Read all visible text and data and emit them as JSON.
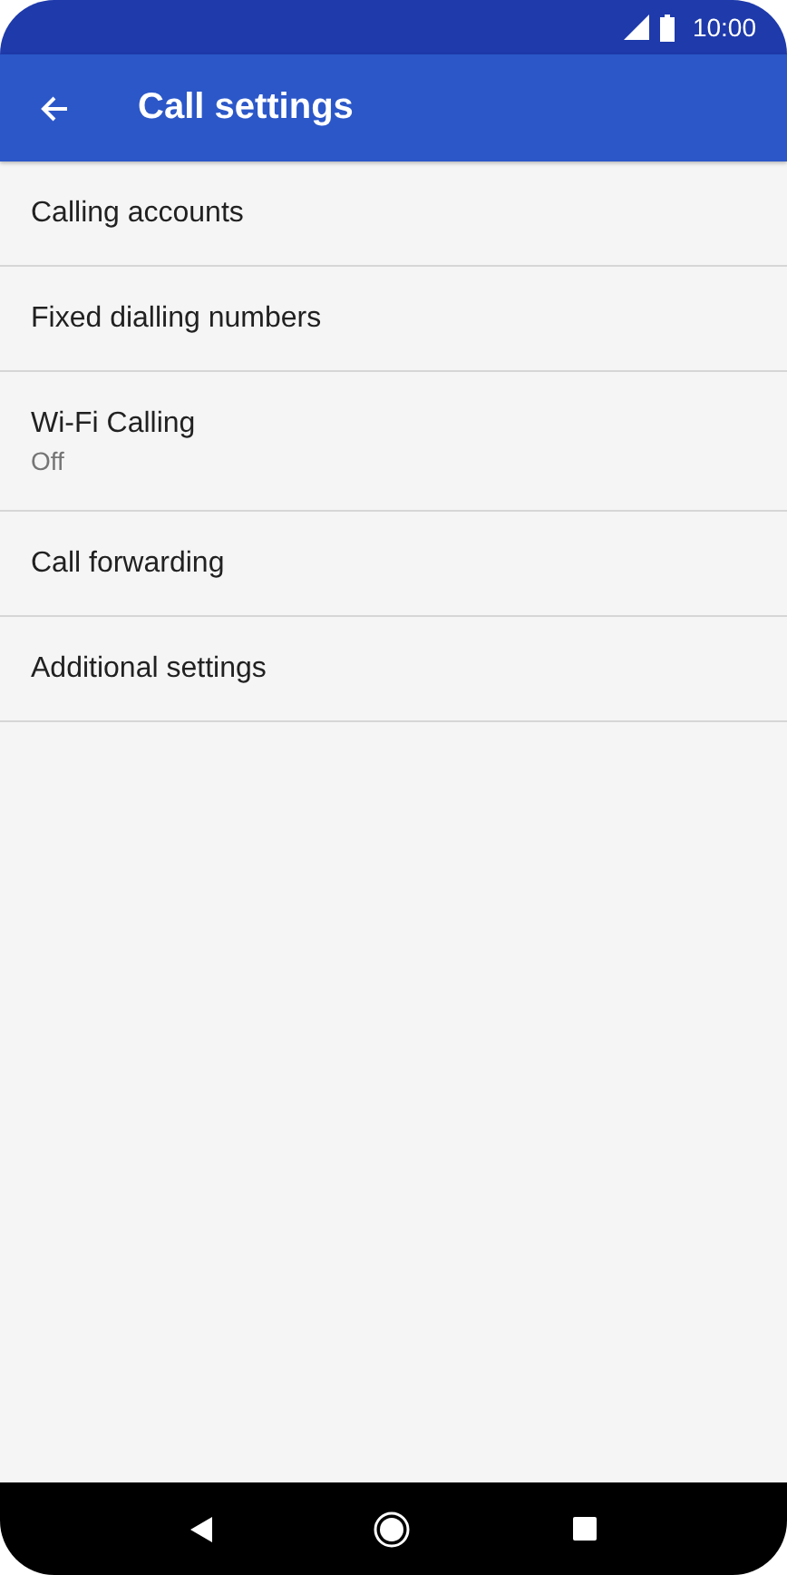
{
  "status_bar": {
    "time": "10:00"
  },
  "app_bar": {
    "title": "Call settings"
  },
  "items": [
    {
      "title": "Calling accounts"
    },
    {
      "title": "Fixed dialling numbers"
    },
    {
      "title": "Wi-Fi Calling",
      "subtitle": "Off"
    },
    {
      "title": "Call forwarding"
    },
    {
      "title": "Additional settings"
    }
  ]
}
